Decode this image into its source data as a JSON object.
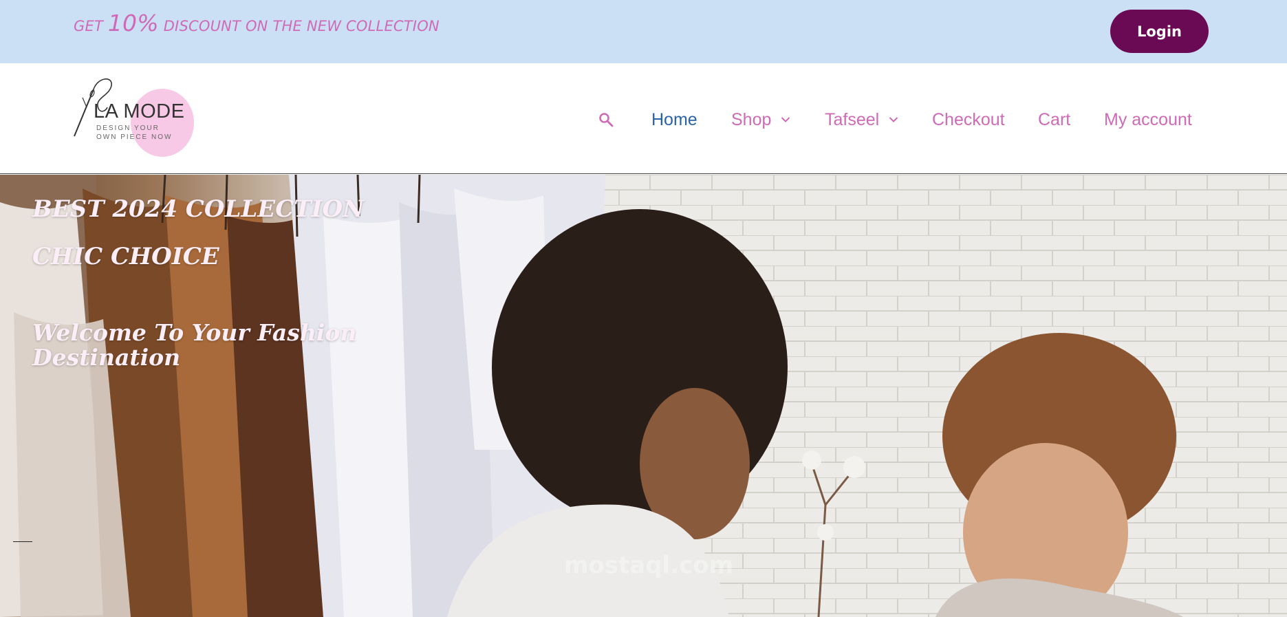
{
  "promo": {
    "prefix": "GET ",
    "highlight": "10%",
    "suffix": " DISCOUNT ON THE NEW COLLECTION",
    "login_label": "Login"
  },
  "logo": {
    "name": "LA MODE",
    "tagline_line1": "DESIGN YOUR",
    "tagline_line2": "OWN PIECE NOW"
  },
  "nav": {
    "search_icon": "search-icon",
    "items": [
      {
        "label": "Home",
        "active": true
      },
      {
        "label": "Shop",
        "dropdown": true
      },
      {
        "label": "Tafseel",
        "dropdown": true
      },
      {
        "label": "Checkout"
      },
      {
        "label": "Cart"
      },
      {
        "label": "My account"
      }
    ]
  },
  "hero": {
    "title_line1": "BEST 2024 COLLECTION",
    "title_line2": "CHIC CHOICE",
    "welcome": "Welcome To Your Fashion Destination",
    "watermark": "mostaql.com"
  },
  "colors": {
    "promo_bg": "#cbe0f5",
    "accent_pink": "#cf6bb6",
    "login_bg": "#6a0a55",
    "nav_active": "#2a64a8"
  }
}
